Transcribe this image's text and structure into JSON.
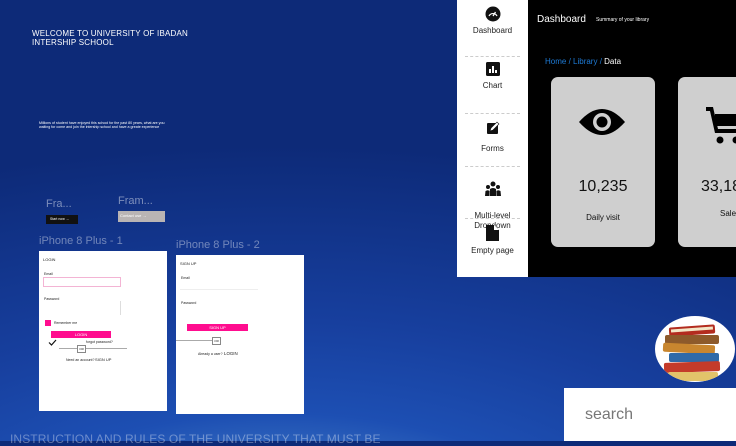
{
  "welcome": {
    "line1": "WELCOME TO UNIVERSITY OF IBADAN",
    "line2": "INTERSHIP SCHOOL"
  },
  "intro": {
    "paragraph": "Millions of student have enjoyed this school for the past 80 years, what are you waiting for come and join the intership school and have a greate experience"
  },
  "frames": {
    "frame1_label": "Fra...",
    "frame2_label": "Fram...",
    "start_button": "Start now →",
    "contact_button": "Contact use →"
  },
  "iphone1": {
    "label": "iPhone 8 Plus - 1",
    "title": "LOGIN",
    "email_label": "Email",
    "password_label": "Password",
    "remember_label": "Remember me",
    "login_button": "LOGIN",
    "forgot_label": "forgot password?",
    "or_label": "OR",
    "no_account": "Need an account?",
    "signup_link": "SIGN UP"
  },
  "iphone2": {
    "label": "iPhone 8 Plus - 2",
    "title": "SIGN UP",
    "email_label": "Email",
    "password_label": "Password",
    "signup_button": "SIGN UP",
    "or_label": "OR",
    "have_account": "Already a user?",
    "login_link": "LOGIN"
  },
  "sidebar": {
    "items": [
      {
        "label": "Dashboard",
        "icon": "dashboard-gauge-icon"
      },
      {
        "label": "Chart",
        "icon": "bar-chart-icon"
      },
      {
        "label": "Forms",
        "icon": "edit-form-icon"
      },
      {
        "label": "Multi-level\nDropdown",
        "icon": "users-group-icon"
      },
      {
        "label": "Empty page",
        "icon": "file-icon"
      }
    ]
  },
  "dashboard": {
    "title": "Dashboard",
    "subtitle": "Summary of your library",
    "breadcrumb": {
      "home": "Home",
      "library": "Library",
      "current": "Data",
      "separator": " / "
    },
    "cards": [
      {
        "value": "10,235",
        "label": "Daily visit",
        "icon": "eye-icon"
      },
      {
        "value": "33,18",
        "label": "Sale",
        "icon": "shopping-cart-icon"
      }
    ],
    "colors": {
      "breadcrumb_link": "#1e7bd6",
      "background": "#000000",
      "card": "#cfcfcf"
    }
  },
  "search": {
    "placeholder": "search"
  },
  "footer": {
    "heading": "INSTRUCTION AND RULES OF THE UNIVERSITY THAT MUST BE"
  },
  "colors": {
    "accent": "#ff0d8f"
  }
}
